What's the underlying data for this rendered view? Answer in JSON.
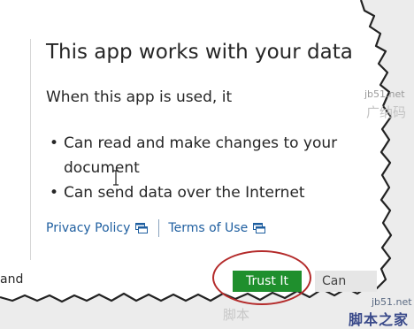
{
  "dialog": {
    "title": "This app works with your data",
    "subtitle": "When this app is used, it",
    "permissions": [
      "Can read and make changes to your",
      "document",
      "Can send data over the Internet"
    ],
    "links": {
      "privacy": "Privacy Policy",
      "terms": "Terms of Use"
    },
    "partial_left_text": "and",
    "buttons": {
      "trust": "Trust It",
      "cancel": "Can"
    }
  },
  "watermarks": {
    "site_top": "jb51.net",
    "site_bottom": "jb51.net",
    "faint_top": "广纳码",
    "chars_bottom": "脚本之家",
    "brand_bottom": "脚本"
  },
  "icons": {
    "external_link": "external-link-icon",
    "text_cursor": "i-beam-cursor-icon"
  },
  "colors": {
    "trust_button": "#1f8f2d",
    "link": "#1f5fa0",
    "highlight": "#b42b2b",
    "cancel_button": "#e6e6e6"
  }
}
